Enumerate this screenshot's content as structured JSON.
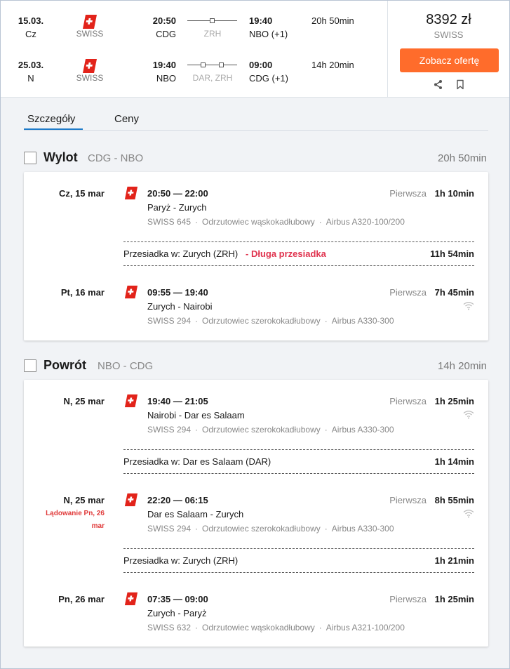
{
  "summary": {
    "outbound": {
      "date": "15.03.",
      "weekday": "Cz",
      "airline": "SWISS",
      "dep_time": "20:50",
      "dep_code": "CDG",
      "via": "ZRH",
      "arr_time": "19:40",
      "arr_code": "NBO (+1)",
      "duration": "20h 50min"
    },
    "return": {
      "date": "25.03.",
      "weekday": "N",
      "airline": "SWISS",
      "dep_time": "19:40",
      "dep_code": "NBO",
      "via": "DAR, ZRH",
      "arr_time": "09:00",
      "arr_code": "CDG (+1)",
      "duration": "14h 20min"
    },
    "price": "8392 zł",
    "price_airline": "SWISS",
    "offer_button": "Zobacz ofertę"
  },
  "tabs": [
    "Szczegóły",
    "Ceny"
  ],
  "outbound": {
    "title": "Wylot",
    "codes": "CDG - NBO",
    "total": "20h 50min",
    "segments": [
      {
        "date": "Cz, 15 mar",
        "times": "20:50 — 22:00",
        "cities": "Paryż - Zurych",
        "flight": "SWISS 645",
        "aircraft_type": "Odrzutowiec wąskokadłubowy",
        "aircraft": "Airbus A320-100/200",
        "cabin": "Pierwsza",
        "duration": "1h 10min"
      },
      {
        "date": "Pt, 16 mar",
        "times": "09:55 — 19:40",
        "cities": "Zurych - Nairobi",
        "flight": "SWISS 294",
        "aircraft_type": "Odrzutowiec szerokokadłubowy",
        "aircraft": "Airbus A330-300",
        "cabin": "Pierwsza",
        "duration": "7h 45min"
      }
    ],
    "layovers": [
      {
        "text": "Przesiadka w: Zurych (ZRH)",
        "warning": "- Długa przesiadka",
        "duration": "11h 54min"
      }
    ]
  },
  "return": {
    "title": "Powrót",
    "codes": "NBO - CDG",
    "total": "14h 20min",
    "segments": [
      {
        "date": "N, 25 mar",
        "times": "19:40 — 21:05",
        "cities": "Nairobi - Dar es Salaam",
        "flight": "SWISS 294",
        "aircraft_type": "Odrzutowiec szerokokadłubowy",
        "aircraft": "Airbus A330-300",
        "cabin": "Pierwsza",
        "duration": "1h 25min"
      },
      {
        "date": "N, 25 mar",
        "landing_note": "Lądowanie Pn, 26 mar",
        "times": "22:20 — 06:15",
        "cities": "Dar es Salaam - Zurych",
        "flight": "SWISS 294",
        "aircraft_type": "Odrzutowiec szerokokadłubowy",
        "aircraft": "Airbus A330-300",
        "cabin": "Pierwsza",
        "duration": "8h 55min"
      },
      {
        "date": "Pn, 26 mar",
        "times": "07:35 — 09:00",
        "cities": "Zurych - Paryż",
        "flight": "SWISS 632",
        "aircraft_type": "Odrzutowiec wąskokadłubowy",
        "aircraft": "Airbus A321-100/200",
        "cabin": "Pierwsza",
        "duration": "1h 25min"
      }
    ],
    "layovers": [
      {
        "text": "Przesiadka w: Dar es Salaam (DAR)",
        "duration": "1h 14min"
      },
      {
        "text": "Przesiadka w: Zurych (ZRH)",
        "duration": "1h 21min"
      }
    ]
  },
  "colors": {
    "accent": "#ff6c2b",
    "tab_underline": "#1f7bc9",
    "warning": "#e0344f",
    "airline_red": "#e2231a"
  },
  "icons": {
    "airline_logo": "swiss-cross-logo-icon",
    "share": "share-icon",
    "bookmark": "bookmark-icon",
    "wifi": "wifi-icon",
    "checkbox": "checkbox-icon"
  }
}
